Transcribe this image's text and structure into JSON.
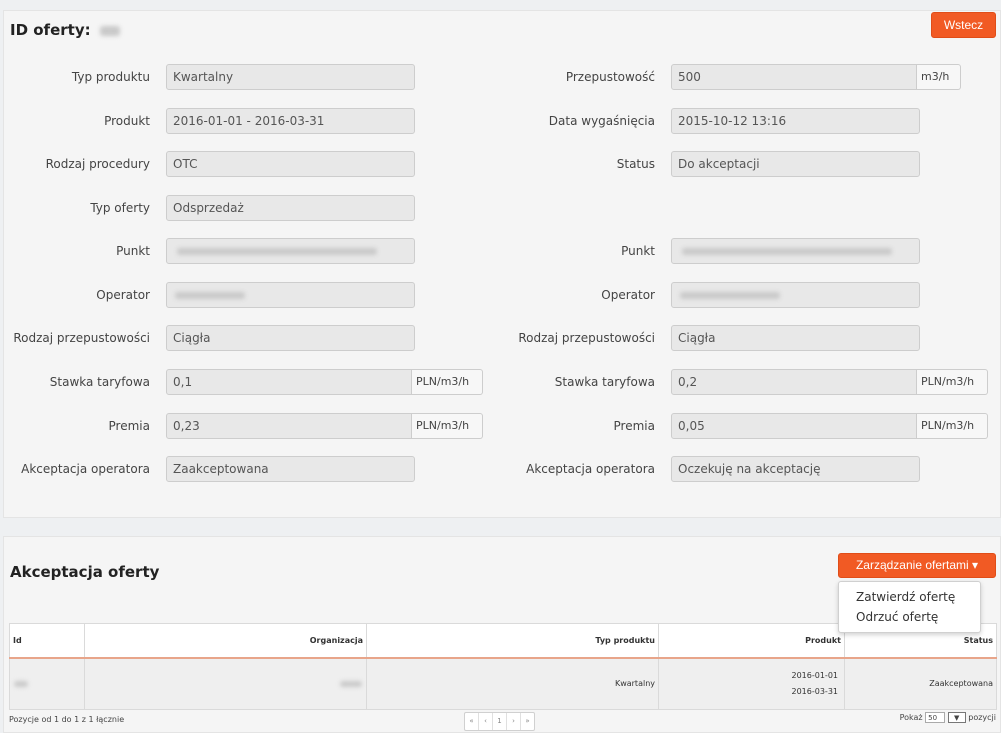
{
  "offer": {
    "title_label": "ID oferty:",
    "back_label": "Wstecz",
    "fields": [
      {
        "label": "Typ produktu",
        "value": "Kwartalny"
      },
      {
        "label": "Przepustowość",
        "value": "500",
        "unit": "m3/h"
      },
      {
        "label": "Produkt",
        "value": "2016-01-01 - 2016-03-31"
      },
      {
        "label": "Data wygaśnięcia",
        "value": "2015-10-12 13:16"
      },
      {
        "label": "Rodzaj procedury",
        "value": "OTC"
      },
      {
        "label": "Status",
        "value": "Do akceptacji"
      },
      {
        "label": "Typ oferty",
        "value": "Odsprzedaż"
      },
      {
        "label": "Punkt",
        "value": ""
      },
      {
        "label": "Punkt",
        "value": ""
      },
      {
        "label": "Operator",
        "value": ""
      },
      {
        "label": "Operator",
        "value": ""
      },
      {
        "label": "Rodzaj przepustowości",
        "value": "Ciągła"
      },
      {
        "label": "Rodzaj przepustowości",
        "value": "Ciągła"
      },
      {
        "label": "Stawka taryfowa",
        "value": "0,1",
        "unit": "PLN/m3/h"
      },
      {
        "label": "Stawka taryfowa",
        "value": "0,2",
        "unit": "PLN/m3/h"
      },
      {
        "label": "Premia",
        "value": "0,23",
        "unit": "PLN/m3/h"
      },
      {
        "label": "Premia",
        "value": "0,05",
        "unit": "PLN/m3/h"
      },
      {
        "label": "Akceptacja operatora",
        "value": "Zaakceptowana"
      },
      {
        "label": "Akceptacja operatora",
        "value": "Oczekuję na akceptację"
      }
    ]
  },
  "acceptance": {
    "title": "Akceptacja oferty",
    "manage_button": "Zarządzanie ofertami ▾",
    "menu": [
      "Zatwierdź ofertę",
      "Odrzuć ofertę"
    ],
    "columns": [
      "Id",
      "Organizacja",
      "Typ produktu",
      "Produkt",
      "Status"
    ],
    "rows": [
      {
        "typ": "Kwartalny",
        "produkt_start": "2016-01-01",
        "produkt_end": "2016-03-31",
        "status": "Zaakceptowana"
      }
    ],
    "footer_info": "Pozycje od 1 do 1 z 1 łącznie",
    "pager": [
      "«",
      "‹",
      "1",
      "›",
      "»"
    ],
    "page_size_label": "Pokaż",
    "page_size_value": "50",
    "page_size_suffix": "pozycji"
  },
  "colors": {
    "accent": "#f15a24"
  }
}
